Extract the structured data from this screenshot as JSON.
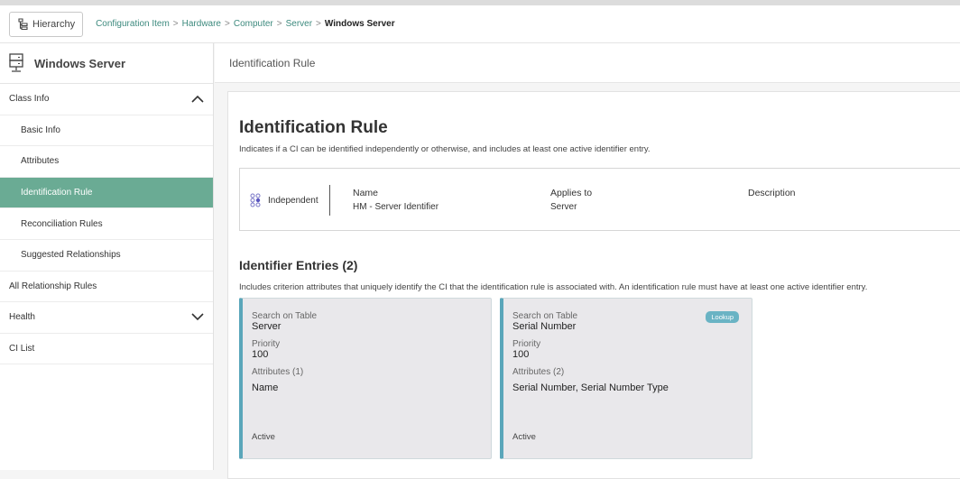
{
  "header": {
    "hierarchy_label": "Hierarchy",
    "breadcrumb": [
      "Configuration Item",
      "Hardware",
      "Computer",
      "Server"
    ],
    "breadcrumb_current": "Windows Server",
    "sep": ">"
  },
  "sidebar": {
    "title": "Windows Server",
    "items": [
      {
        "label": "Class Info"
      },
      {
        "label": "Basic Info"
      },
      {
        "label": "Attributes"
      },
      {
        "label": "Identification Rule"
      },
      {
        "label": "Reconciliation Rules"
      },
      {
        "label": "Suggested Relationships"
      },
      {
        "label": "All Relationship Rules"
      },
      {
        "label": "Health"
      },
      {
        "label": "CI List"
      }
    ]
  },
  "main": {
    "header": "Identification Rule",
    "title": "Identification Rule",
    "description": "Indicates if a CI can be identified independently or otherwise, and includes at least one active identifier entry.",
    "rule": {
      "type": "Independent",
      "name_label": "Name",
      "name": "HM - Server Identifier",
      "applies_label": "Applies to",
      "applies": "Server",
      "description_label": "Description"
    },
    "entries_title": "Identifier Entries (2)",
    "entries_description": "Includes criterion attributes that uniquely identify the CI that the identification rule is associated with. An identification rule must have at least one active identifier entry.",
    "entries": [
      {
        "table_label": "Search on Table",
        "table": "Server",
        "priority_label": "Priority",
        "priority": "100",
        "attributes_label": "Attributes (1)",
        "attributes": "Name",
        "status": "Active"
      },
      {
        "table_label": "Search on Table",
        "table": "Serial Number",
        "priority_label": "Priority",
        "priority": "100",
        "attributes_label": "Attributes (2)",
        "attributes": "Serial Number, Serial Number Type",
        "status": "Active",
        "badge": "Lookup"
      }
    ]
  }
}
